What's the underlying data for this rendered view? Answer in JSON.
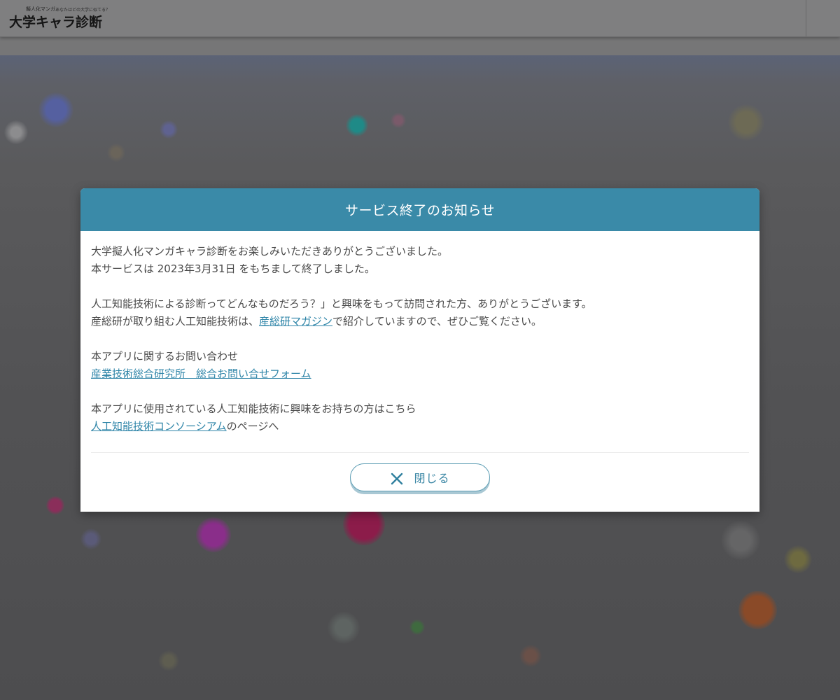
{
  "header": {
    "logo_small": "擬人化マンガ",
    "logo_tagline": "あなたはどの大学に似てる？",
    "logo_main": "大学キャラ診断"
  },
  "modal": {
    "title": "サービス終了のお知らせ",
    "para1": {
      "line1": "大学擬人化マンガキャラ診断をお楽しみいただきありがとうございました。",
      "line2": "本サービスは 2023年3月31日 をもちまして終了しました。"
    },
    "para2": {
      "line1": "人工知能技術による診断ってどんなものだろう？」と興味をもって訪問された方、ありがとうございます。",
      "line2_prefix": "産総研が取り組む人工知能技術は、",
      "line2_link": "産総研マガジン",
      "line2_suffix": "で紹介していますので、ぜひご覧ください。"
    },
    "para3": {
      "line1": "本アプリに関するお問い合わせ",
      "link": "産業技術総合研究所　総合お問い合せフォーム"
    },
    "para4": {
      "line1": "本アプリに使用されている人工知能技術に興味をお持ちの方はこちら",
      "link": "人工知能技術コンソーシアム",
      "suffix": "のページへ"
    },
    "close_label": "閉じる",
    "close_icon": "close-icon"
  },
  "colors": {
    "accent": "#3a8aa8",
    "link": "#2f85a8",
    "text": "#4a4a4a",
    "backdrop": "#4d4d4f"
  }
}
